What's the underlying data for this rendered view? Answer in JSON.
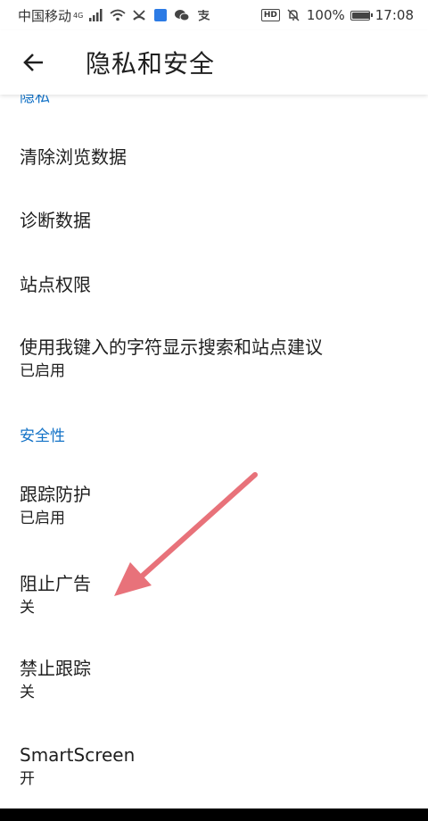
{
  "status_bar": {
    "carrier": "中国移动",
    "network": "4G",
    "battery_percent": "100%",
    "time": "17:08",
    "hd_label": "HD",
    "icons": [
      "signal-icon",
      "wifi-icon",
      "missed-call-icon",
      "app-icon",
      "wechat-icon",
      "alipay-icon",
      "mute-icon",
      "battery-icon"
    ]
  },
  "header": {
    "title": "隐私和安全",
    "back_icon": "back-arrow-icon"
  },
  "sections": {
    "privacy": {
      "header": "隐私",
      "items": [
        {
          "title": "清除浏览数据"
        },
        {
          "title": "诊断数据"
        },
        {
          "title": "站点权限"
        },
        {
          "title": "使用我键入的字符显示搜索和站点建议",
          "subtitle": "已启用"
        }
      ]
    },
    "security": {
      "header": "安全性",
      "items": [
        {
          "title": "跟踪防护",
          "subtitle": "已启用"
        },
        {
          "title": "阻止广告",
          "subtitle": "关"
        },
        {
          "title": "禁止跟踪",
          "subtitle": "关"
        },
        {
          "title": "SmartScreen",
          "subtitle": "开"
        }
      ]
    }
  },
  "colors": {
    "accent": "#1473c7",
    "annotation_arrow": "#e8727a"
  }
}
